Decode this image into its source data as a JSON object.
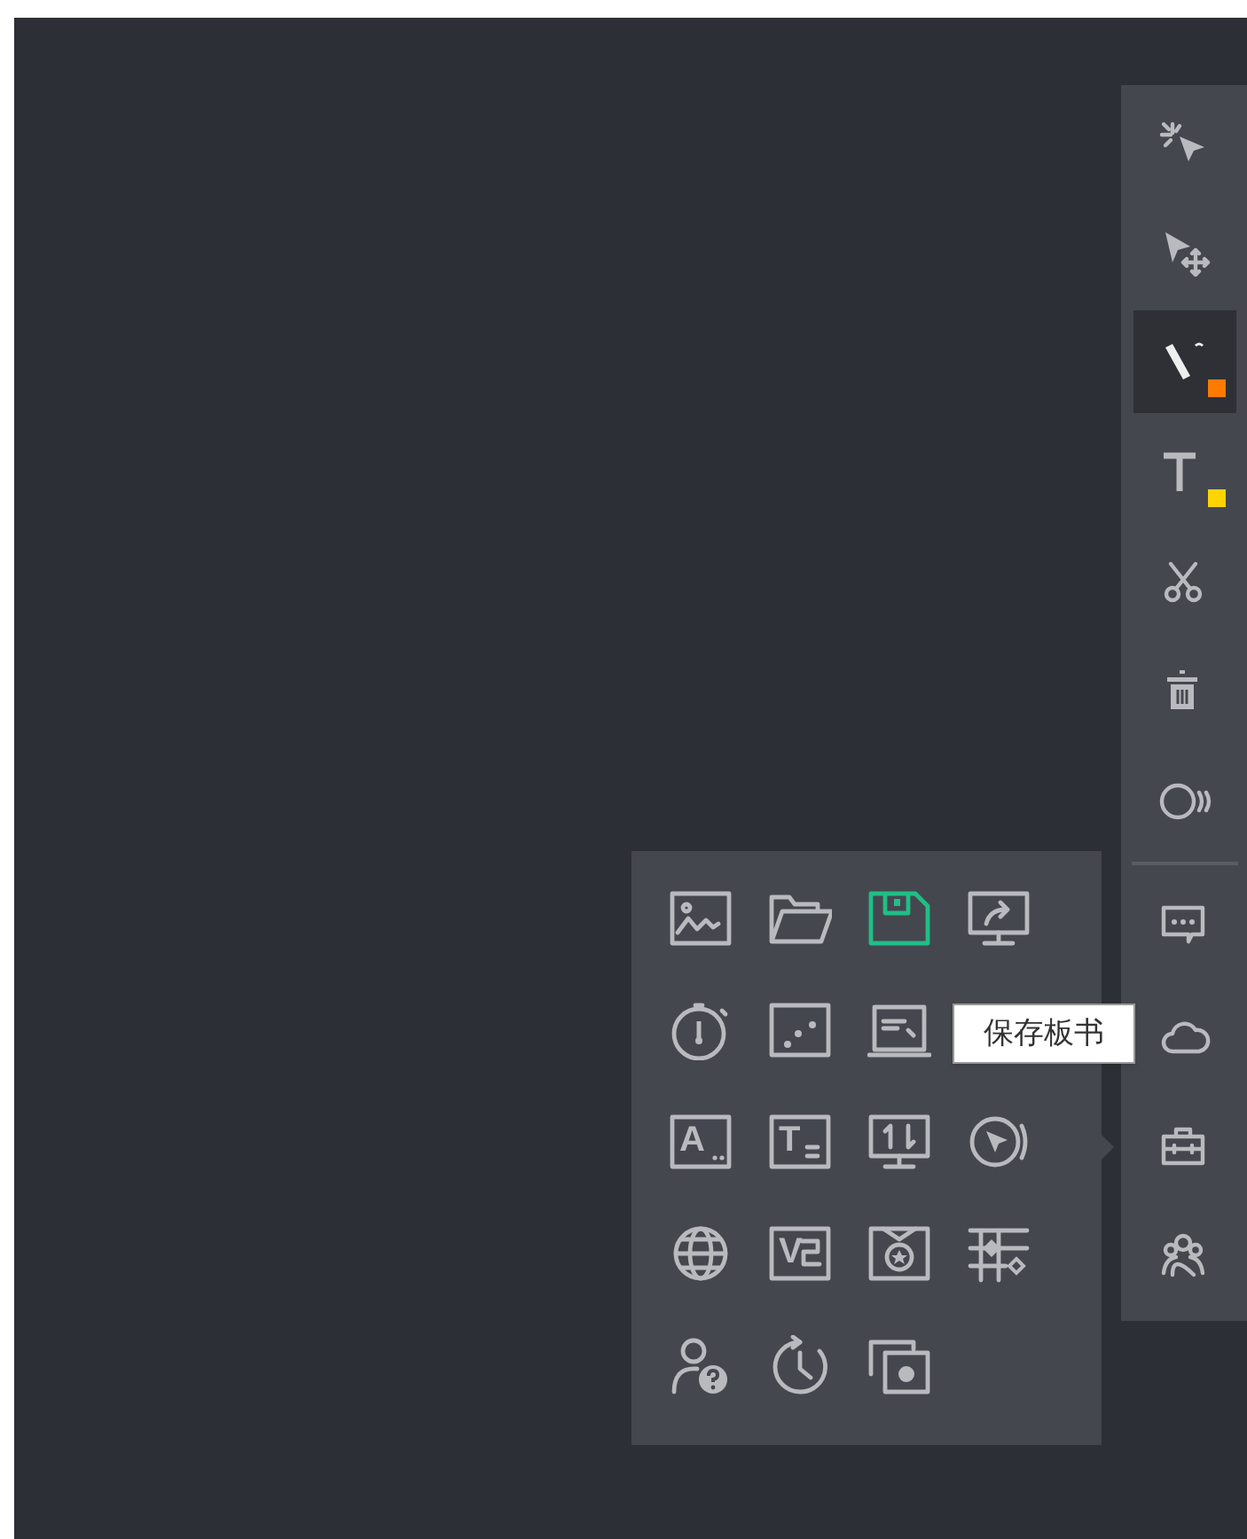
{
  "toolbar": {
    "items": [
      {
        "selected": false
      },
      {
        "selected": false
      },
      {
        "selected": true,
        "color": "#ff7a00"
      },
      {
        "selected": false,
        "color": "#ffd400"
      },
      {
        "selected": false
      },
      {
        "selected": false
      },
      {
        "selected": false
      },
      {
        "selected": false
      },
      {
        "selected": false
      },
      {
        "selected": false
      },
      {
        "selected": false
      }
    ]
  },
  "popup": {
    "items": [
      {
        "selected": false
      },
      {
        "selected": false
      },
      {
        "selected": true
      },
      {
        "selected": false
      },
      {
        "selected": false
      },
      {
        "selected": false
      },
      {
        "selected": false
      },
      {
        "selected": false,
        "label": "A"
      },
      {
        "selected": false,
        "label": "T"
      },
      {
        "selected": false
      },
      {
        "selected": false
      },
      {
        "selected": false
      },
      {
        "selected": false,
        "label": "V"
      },
      {
        "selected": false
      },
      {
        "selected": false
      },
      {
        "selected": false
      },
      {
        "selected": false
      },
      {
        "selected": false
      }
    ]
  },
  "tooltip": {
    "text": "保存板书"
  }
}
